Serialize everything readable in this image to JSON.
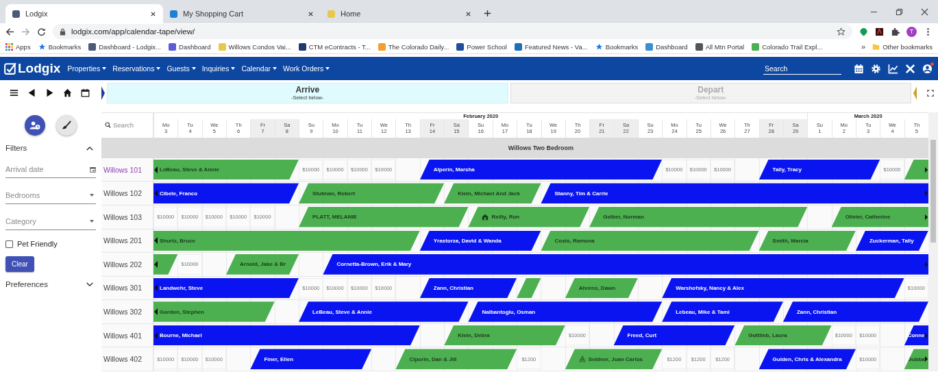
{
  "browser": {
    "tabs": [
      {
        "title": "Lodgix",
        "selected": true,
        "color": "#4a5a78"
      },
      {
        "title": "My Shopping Cart",
        "selected": false,
        "color": "#1e7fd8"
      },
      {
        "title": "Home",
        "selected": false,
        "color": "#e8c84a"
      }
    ],
    "url": "lodgix.com/app/calendar-tape/view/",
    "profile_initial": "T",
    "bookmarks": [
      {
        "label": "Apps",
        "kind": "grid"
      },
      {
        "label": "Bookmarks",
        "kind": "star",
        "color": "#1a73e8"
      },
      {
        "label": "Dashboard - Lodgix...",
        "kind": "favicon",
        "color": "#4a5a78"
      },
      {
        "label": "Dashboard",
        "kind": "favicon",
        "color": "#5b5bd6"
      },
      {
        "label": "Willows Condos Vai...",
        "kind": "favicon",
        "color": "#e8c84a"
      },
      {
        "label": "CTM eContracts - T...",
        "kind": "favicon",
        "color": "#1f3a70"
      },
      {
        "label": "The Colorado Daily...",
        "kind": "favicon",
        "color": "#f0a030"
      },
      {
        "label": "Power School",
        "kind": "favicon",
        "color": "#1f4f9a"
      },
      {
        "label": "Featured News - Va...",
        "kind": "favicon",
        "color": "#1d6fb8"
      },
      {
        "label": "Bookmarks",
        "kind": "star",
        "color": "#1a73e8"
      },
      {
        "label": "Dashboard",
        "kind": "favicon",
        "color": "#3a8fd0"
      },
      {
        "label": "All Mtn Portal",
        "kind": "favicon",
        "color": "#555555"
      },
      {
        "label": "Colorado Trail Expl...",
        "kind": "favicon",
        "color": "#4caf50"
      }
    ],
    "overflow": "»",
    "other_bookmarks": "Other bookmarks"
  },
  "app": {
    "logo": "Lodgix",
    "nav": [
      "Properties",
      "Reservations",
      "Guests",
      "Inquiries",
      "Calendar",
      "Work Orders"
    ],
    "search_placeholder": "Search",
    "notification": true
  },
  "toolbar": {
    "panels": [
      {
        "title": "Arrive",
        "hint": "-Select below-",
        "selected": true
      },
      {
        "title": "Depart",
        "hint": "-Select below-",
        "selected": false
      }
    ]
  },
  "sidebar": {
    "filters_title": "Filters",
    "filters_expanded": true,
    "fields": [
      {
        "kind": "date",
        "placeholder": "Arrival date"
      },
      {
        "kind": "select",
        "placeholder": "Bedrooms"
      },
      {
        "kind": "select",
        "placeholder": "Category"
      },
      {
        "kind": "checkbox",
        "label": "Pet Friendly",
        "checked": false
      }
    ],
    "clear": "Clear",
    "preferences_title": "Preferences",
    "preferences_expanded": false
  },
  "calendar": {
    "search_placeholder": "Search",
    "months": [
      {
        "label": "February 2020",
        "days": [
          {
            "weekday": "Mo",
            "date": "3",
            "weekend": false
          },
          {
            "weekday": "Tu",
            "date": "4",
            "weekend": false
          },
          {
            "weekday": "We",
            "date": "5",
            "weekend": false
          },
          {
            "weekday": "Th",
            "date": "6",
            "weekend": false
          },
          {
            "weekday": "Fr",
            "date": "7",
            "weekend": true
          },
          {
            "weekday": "Sa",
            "date": "8",
            "weekend": true
          },
          {
            "weekday": "Su",
            "date": "9",
            "weekend": false
          },
          {
            "weekday": "Mo",
            "date": "10",
            "weekend": false
          },
          {
            "weekday": "Tu",
            "date": "11",
            "weekend": false
          },
          {
            "weekday": "We",
            "date": "12",
            "weekend": false
          },
          {
            "weekday": "Th",
            "date": "13",
            "weekend": false
          },
          {
            "weekday": "Fr",
            "date": "14",
            "weekend": true
          },
          {
            "weekday": "Sa",
            "date": "15",
            "weekend": true
          },
          {
            "weekday": "Su",
            "date": "16",
            "weekend": false
          },
          {
            "weekday": "Mo",
            "date": "17",
            "weekend": false
          },
          {
            "weekday": "Tu",
            "date": "18",
            "weekend": false
          },
          {
            "weekday": "We",
            "date": "19",
            "weekend": false
          },
          {
            "weekday": "Th",
            "date": "20",
            "weekend": false
          },
          {
            "weekday": "Fr",
            "date": "21",
            "weekend": true
          },
          {
            "weekday": "Sa",
            "date": "22",
            "weekend": true
          },
          {
            "weekday": "Su",
            "date": "23",
            "weekend": false
          },
          {
            "weekday": "Mo",
            "date": "24",
            "weekend": false
          },
          {
            "weekday": "Tu",
            "date": "25",
            "weekend": false
          },
          {
            "weekday": "We",
            "date": "26",
            "weekend": false
          },
          {
            "weekday": "Th",
            "date": "27",
            "weekend": false
          },
          {
            "weekday": "Fr",
            "date": "28",
            "weekend": true
          },
          {
            "weekday": "Sa",
            "date": "29",
            "weekend": true
          }
        ]
      },
      {
        "label": "March 2020",
        "days": [
          {
            "weekday": "Su",
            "date": "1",
            "weekend": false
          },
          {
            "weekday": "Mo",
            "date": "2",
            "weekend": false
          },
          {
            "weekday": "Tu",
            "date": "3",
            "weekend": false
          },
          {
            "weekday": "We",
            "date": "4",
            "weekend": false
          },
          {
            "weekday": "Th",
            "date": "5",
            "weekend": false
          }
        ]
      }
    ],
    "group": "Willows Two Bedroom",
    "units": [
      {
        "name": "Willows 101",
        "highlighted": true,
        "items": [
          {
            "kind": "booking",
            "guest": "LeBeau, Steve & Annie",
            "color": "#4caf50",
            "continues_before": true,
            "continues_after": false
          },
          {
            "kind": "rate",
            "price": "$10000"
          },
          {
            "kind": "rate",
            "price": "$10000"
          },
          {
            "kind": "rate",
            "price": "$10000"
          },
          {
            "kind": "rate",
            "price": "$10000"
          },
          {
            "kind": "booking",
            "guest": "Alperin, Marsha",
            "color": "#0a14f0",
            "continues_before": false,
            "continues_after": false
          },
          {
            "kind": "rate",
            "price": "$10000"
          },
          {
            "kind": "rate",
            "price": "$10000"
          },
          {
            "kind": "rate",
            "price": "$10000"
          },
          {
            "kind": "booking",
            "guest": "Tally, Tracy",
            "color": "#0a14f0",
            "continues_before": false,
            "continues_after": false
          },
          {
            "kind": "rate",
            "price": "$10000"
          },
          {
            "kind": "booking",
            "color": "#4caf50",
            "continues_before": false,
            "continues_after": true
          }
        ]
      },
      {
        "name": "Willows 102",
        "highlighted": false,
        "items": [
          {
            "kind": "booking",
            "guest": "Cibele, Franco",
            "color": "#0a14f0",
            "continues_before": true,
            "continues_after": false
          },
          {
            "kind": "booking",
            "guest": "Stutman, Robert",
            "color": "#4caf50",
            "continues_before": false,
            "continues_after": false
          },
          {
            "kind": "booking",
            "guest": "Klein, Michael And Jack",
            "color": "#4caf50",
            "continues_before": false,
            "continues_after": false
          },
          {
            "kind": "booking",
            "guest": "Stanny, Tim & Carrie",
            "color": "#0a14f0",
            "continues_before": false,
            "continues_after": true
          }
        ]
      },
      {
        "name": "Willows 103",
        "highlighted": false,
        "items": [
          {
            "kind": "rate",
            "price": "$10000"
          },
          {
            "kind": "rate",
            "price": "$10000"
          },
          {
            "kind": "rate",
            "price": "$10000"
          },
          {
            "kind": "rate",
            "price": "$10000"
          },
          {
            "kind": "rate",
            "price": "$10000"
          },
          {
            "kind": "booking",
            "guest": "PLATT, MELANIE",
            "color": "#4caf50",
            "continues_before": false,
            "continues_after": false
          },
          {
            "kind": "booking",
            "guest": "Reilly, Ron",
            "color": "#4caf50",
            "continues_before": false,
            "continues_after": false
          },
          {
            "kind": "booking",
            "guest": "Gelber, Norman",
            "color": "#4caf50",
            "continues_before": false,
            "continues_after": false
          },
          {
            "kind": "booking",
            "guest": "Olivier, Catherine",
            "color": "#4caf50",
            "continues_before": false,
            "continues_after": true
          }
        ]
      },
      {
        "name": "Willows 201",
        "highlighted": false,
        "items": [
          {
            "kind": "booking",
            "guest": "Shurtz, Bruce",
            "color": "#4caf50",
            "continues_before": true,
            "continues_after": false
          },
          {
            "kind": "booking",
            "guest": "Yrastorza, David & Wanda",
            "color": "#0a14f0",
            "continues_before": false,
            "continues_after": false
          },
          {
            "kind": "booking",
            "guest": "Cosio, Ramona",
            "color": "#4caf50",
            "continues_before": false,
            "continues_after": false
          },
          {
            "kind": "booking",
            "guest": "Smith, Marcia",
            "color": "#4caf50",
            "continues_before": false,
            "continues_after": false
          },
          {
            "kind": "booking",
            "guest": "Zuckerman, Tally",
            "color": "#0a14f0",
            "continues_before": false,
            "continues_after": false
          }
        ]
      },
      {
        "name": "Willows 202",
        "highlighted": false,
        "items": [
          {
            "kind": "booking",
            "color": "#4caf50",
            "continues_before": true,
            "continues_after": false
          },
          {
            "kind": "rate",
            "price": "$10000"
          },
          {
            "kind": "booking",
            "guest": "Arnold, Jake & Br",
            "color": "#4caf50",
            "continues_before": false,
            "continues_after": false
          },
          {
            "kind": "booking",
            "guest": "Cornetta-Brown, Erik & Mary",
            "color": "#0a14f0",
            "continues_before": false,
            "continues_after": true
          }
        ]
      },
      {
        "name": "Willows 301",
        "highlighted": false,
        "items": [
          {
            "kind": "booking",
            "guest": "Landwehr, Steve",
            "color": "#0a14f0",
            "continues_before": true,
            "continues_after": false
          },
          {
            "kind": "rate",
            "price": "$10000"
          },
          {
            "kind": "rate",
            "price": "$10000"
          },
          {
            "kind": "rate",
            "price": "$10000"
          },
          {
            "kind": "rate",
            "price": "$10000"
          },
          {
            "kind": "booking",
            "guest": "Zann, Christian",
            "color": "#0a14f0",
            "continues_before": false,
            "continues_after": false
          },
          {
            "kind": "booking",
            "color": "#4caf50",
            "continues_before": false,
            "continues_after": false
          },
          {
            "kind": "booking",
            "guest": "Ahrens, Dawn",
            "color": "#4caf50",
            "continues_before": false,
            "continues_after": false
          },
          {
            "kind": "booking",
            "guest": "Warshofsky, Nancy & Alex",
            "color": "#0a14f0",
            "continues_before": false,
            "continues_after": false
          },
          {
            "kind": "rate",
            "price": "$10000"
          }
        ]
      },
      {
        "name": "Willows 302",
        "highlighted": false,
        "items": [
          {
            "kind": "booking",
            "guest": "Gordon, Stephen",
            "color": "#4caf50",
            "continues_before": true,
            "continues_after": false
          },
          {
            "kind": "booking",
            "guest": "LeBeau, Steve & Annie",
            "color": "#0a14f0",
            "continues_before": false,
            "continues_after": false
          },
          {
            "kind": "booking",
            "guest": "Nalbantoglu, Osman",
            "color": "#0a14f0",
            "continues_before": false,
            "continues_after": false
          },
          {
            "kind": "booking",
            "guest": "Lebeau, Mike & Tami",
            "color": "#0a14f0",
            "continues_before": false,
            "continues_after": false
          },
          {
            "kind": "booking",
            "guest": "Zann, Christian",
            "color": "#0a14f0",
            "continues_before": false,
            "continues_after": false
          }
        ]
      },
      {
        "name": "Willows 401",
        "highlighted": false,
        "items": [
          {
            "kind": "booking",
            "guest": "Bourne, Michael",
            "color": "#0a14f0",
            "continues_before": true,
            "continues_after": false
          },
          {
            "kind": "booking",
            "guest": "Klein, Debra",
            "color": "#4caf50",
            "continues_before": false,
            "continues_after": false
          },
          {
            "kind": "rate",
            "price": "$10000"
          },
          {
            "kind": "booking",
            "guest": "Freed, Curt",
            "color": "#0a14f0",
            "continues_before": false,
            "continues_after": false
          },
          {
            "kind": "booking",
            "guest": "Gottlieb, Laura",
            "color": "#4caf50",
            "continues_before": false,
            "continues_after": false
          },
          {
            "kind": "rate",
            "price": "$10000"
          },
          {
            "kind": "rate",
            "price": "$10000"
          },
          {
            "kind": "booking",
            "guest": "Conne",
            "color": "#0a14f0",
            "continues_before": false,
            "continues_after": true
          }
        ]
      },
      {
        "name": "Willows 402",
        "highlighted": false,
        "items": [
          {
            "kind": "rate",
            "price": "$10000"
          },
          {
            "kind": "rate",
            "price": "$10000"
          },
          {
            "kind": "rate",
            "price": "$10000"
          },
          {
            "kind": "booking",
            "guest": "Finer, Ellen",
            "color": "#0a14f0",
            "continues_before": false,
            "continues_after": false
          },
          {
            "kind": "booking",
            "guest": "Ciporin, Dan & Jill",
            "color": "#4caf50",
            "continues_before": false,
            "continues_after": false
          },
          {
            "kind": "rate",
            "price": "$1200"
          },
          {
            "kind": "booking",
            "guest": "Seldner, Juan Carlos",
            "color": "#4caf50",
            "continues_before": false,
            "continues_after": false
          },
          {
            "kind": "rate",
            "price": "$1200"
          },
          {
            "kind": "rate",
            "price": "$1200"
          },
          {
            "kind": "rate",
            "price": "$1200"
          },
          {
            "kind": "booking",
            "guest": "Gulden, Chris & Alexandra",
            "color": "#0a14f0",
            "continues_before": false,
            "continues_after": false
          },
          {
            "kind": "rate",
            "price": "$10000"
          },
          {
            "kind": "booking",
            "guest": "Gubba",
            "color": "#4caf50",
            "continues_before": false,
            "continues_after": true
          }
        ]
      }
    ]
  }
}
